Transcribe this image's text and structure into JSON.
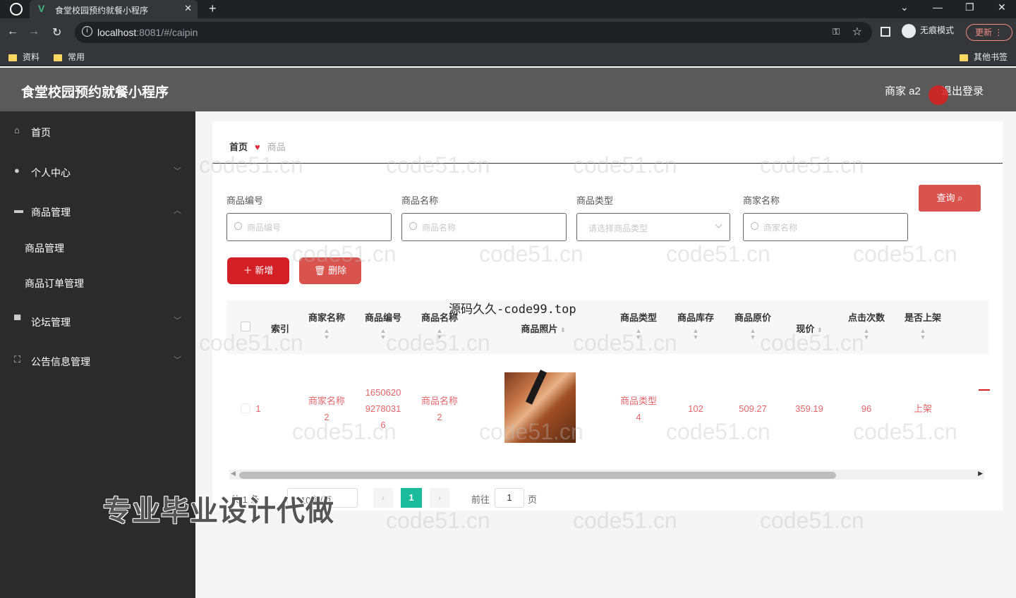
{
  "browser": {
    "tab_title": "食堂校园预约就餐小程序",
    "url_host": "localhost",
    "url_rest": ":8081/#/caipin",
    "incognito_label": "无痕模式",
    "update_label": "更新",
    "bookmarks": [
      "资料",
      "常用"
    ],
    "other_bookmarks": "其他书签"
  },
  "header": {
    "app_title": "食堂校园预约就餐小程序",
    "user": "商家 a2",
    "logout": "退出登录"
  },
  "sidebar": {
    "items": [
      {
        "label": "首页",
        "icon": "home-icon"
      },
      {
        "label": "个人中心",
        "icon": "user-icon"
      },
      {
        "label": "商品管理",
        "icon": "chat-icon"
      },
      {
        "label": "论坛管理",
        "icon": "forum-icon"
      },
      {
        "label": "公告信息管理",
        "icon": "announcement-icon"
      }
    ],
    "sub_items": [
      "商品管理",
      "商品订单管理"
    ]
  },
  "breadcrumb": {
    "home": "首页",
    "current": "商品"
  },
  "filters": {
    "goods_no_label": "商品编号",
    "goods_no_placeholder": "商品编号",
    "goods_name_label": "商品名称",
    "goods_name_placeholder": "商品名称",
    "goods_type_label": "商品类型",
    "goods_type_placeholder": "请选择商品类型",
    "merchant_label": "商家名称",
    "merchant_placeholder": "商家名称",
    "query_button": "查询"
  },
  "actions": {
    "add": "新增",
    "delete": "删除"
  },
  "table": {
    "headers": {
      "index": "索引",
      "merchant": "商家名称",
      "goods_no": "商品编号",
      "goods_name": "商品名称",
      "photo": "商品照片",
      "goods_type": "商品类型",
      "stock": "商品库存",
      "original_price": "商品原价",
      "price": "现价",
      "clicks": "点击次数",
      "on_sale": "是否上架"
    },
    "rows": [
      {
        "index": "1",
        "merchant_l1": "商家名称",
        "merchant_l2": "2",
        "goods_no_l1": "1650620",
        "goods_no_l2": "9278031",
        "goods_no_l3": "6",
        "goods_name_l1": "商品名称",
        "goods_name_l2": "2",
        "goods_type_l1": "商品类型",
        "goods_type_l2": "4",
        "stock": "102",
        "original_price": "509.27",
        "price": "359.19",
        "clicks": "96",
        "on_sale": "上架"
      }
    ]
  },
  "pagination": {
    "total": "共 1 条",
    "page_size": "10条/页",
    "current": "1",
    "goto_prefix": "前往",
    "goto_value": "1",
    "goto_suffix": "页"
  },
  "watermark": "code51.cn",
  "overlay_text": "源码久久-code99.top",
  "promo_text": "专业毕业设计代做",
  "colors": {
    "primary_red": "#d32027",
    "query_red": "#d9534f",
    "page_active": "#1abc9c",
    "sidebar": "#2b2b2b",
    "header": "#5a5a5a"
  }
}
